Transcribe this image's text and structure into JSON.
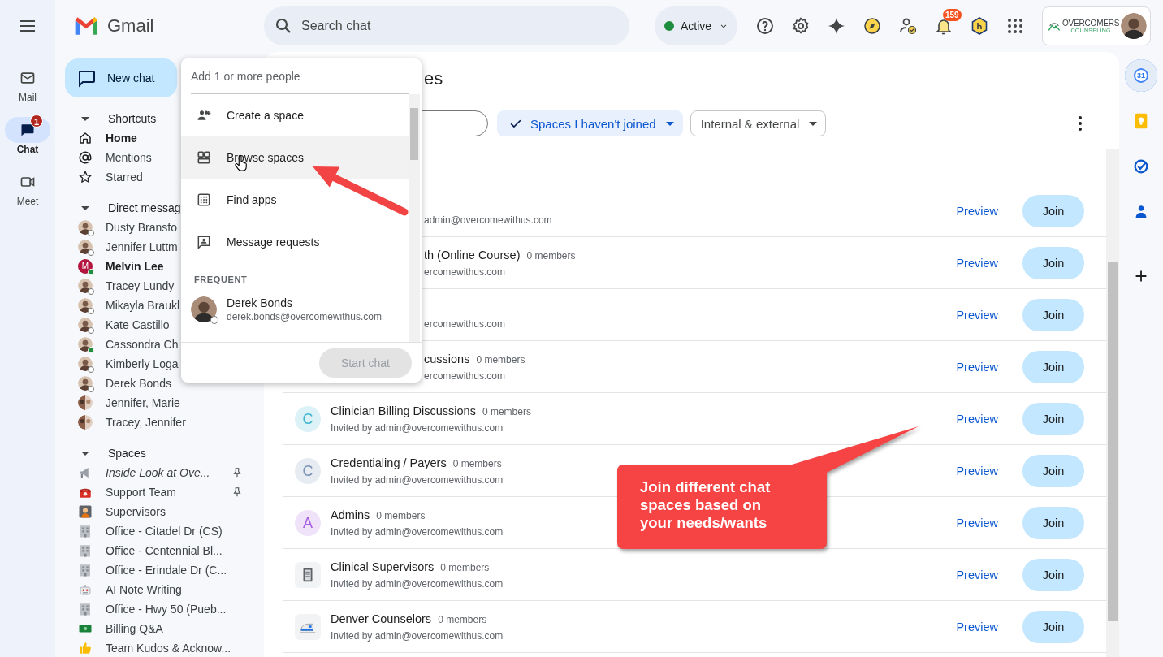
{
  "rail": {
    "items": [
      {
        "kind": "mail",
        "label": "Mail",
        "selected": false
      },
      {
        "kind": "chat",
        "label": "Chat",
        "selected": true,
        "badge": "1"
      },
      {
        "kind": "meet",
        "label": "Meet",
        "selected": false
      }
    ]
  },
  "app": {
    "name": "Gmail"
  },
  "search": {
    "placeholder": "Search chat"
  },
  "presence": {
    "label": "Active"
  },
  "toolbar": {
    "notification_count": "159"
  },
  "account": {
    "org_name": "OVERCOMERS",
    "org_tagline": "COUNSELING"
  },
  "sidebar": {
    "new_chat": "New chat",
    "sections": [
      {
        "title": "Shortcuts",
        "expanded": true,
        "items": [
          {
            "kind": "home",
            "label": "Home",
            "unread": true
          },
          {
            "kind": "mention",
            "label": "Mentions",
            "unread": false
          },
          {
            "kind": "star",
            "label": "Starred",
            "unread": false
          }
        ]
      },
      {
        "title": "Direct messag",
        "expanded": true,
        "items": [
          {
            "kind": "person",
            "label": "Dusty Bransfo",
            "unread": false,
            "online": false
          },
          {
            "kind": "person",
            "label": "Jennifer Luttm",
            "unread": false,
            "online": false
          },
          {
            "kind": "letter",
            "initial": "M",
            "label": "Melvin Lee",
            "unread": true,
            "online": true
          },
          {
            "kind": "person",
            "label": "Tracey Lundy",
            "unread": false,
            "online": false
          },
          {
            "kind": "person",
            "label": "Mikayla Braukl",
            "unread": false,
            "online": false
          },
          {
            "kind": "person",
            "label": "Kate Castillo",
            "unread": false,
            "online": false
          },
          {
            "kind": "person",
            "label": "Cassondra Ch",
            "unread": false,
            "online": true
          },
          {
            "kind": "person",
            "label": "Kimberly Loga",
            "unread": false,
            "online": false
          },
          {
            "kind": "person",
            "label": "Derek Bonds",
            "unread": false,
            "online": false
          },
          {
            "kind": "group",
            "label": "Jennifer, Marie",
            "unread": false,
            "online": false
          },
          {
            "kind": "group",
            "label": "Tracey, Jennifer",
            "unread": false,
            "online": false
          }
        ]
      },
      {
        "title": "Spaces",
        "expanded": true,
        "items": [
          {
            "kind": "megaphone",
            "label": "Inside Look at Ove...",
            "unread": false,
            "italic": true,
            "pinned": true
          },
          {
            "kind": "phone",
            "label": "Support Team",
            "unread": false,
            "italic": false,
            "pinned": true
          },
          {
            "kind": "teacher",
            "label": "Supervisors",
            "unread": false,
            "italic": false,
            "pinned": false
          },
          {
            "kind": "building",
            "label": "Office - Citadel Dr (CS)",
            "unread": false,
            "italic": false,
            "pinned": false
          },
          {
            "kind": "building",
            "label": "Office - Centennial Bl...",
            "unread": false,
            "italic": false,
            "pinned": false
          },
          {
            "kind": "building",
            "label": "Office - Erindale Dr (C...",
            "unread": false,
            "italic": false,
            "pinned": false
          },
          {
            "kind": "robot",
            "label": "AI Note Writing",
            "unread": false,
            "italic": false,
            "pinned": false
          },
          {
            "kind": "building",
            "label": "Office - Hwy 50 (Pueb...",
            "unread": false,
            "italic": false,
            "pinned": false
          },
          {
            "kind": "cash",
            "label": "Billing Q&A",
            "unread": false,
            "italic": false,
            "pinned": false
          },
          {
            "kind": "thumb",
            "label": "Team Kudos & Acknow...",
            "unread": false,
            "italic": false,
            "pinned": false
          }
        ]
      }
    ]
  },
  "new_chat_menu": {
    "placeholder": "Add 1 or more people",
    "actions": [
      {
        "kind": "create",
        "label": "Create a space",
        "hovered": false
      },
      {
        "kind": "browse",
        "label": "Browse spaces",
        "hovered": true
      },
      {
        "kind": "apps",
        "label": "Find apps",
        "hovered": false
      },
      {
        "kind": "requests",
        "label": "Message requests",
        "hovered": false
      }
    ],
    "section_title": "FREQUENT",
    "contacts": [
      {
        "name": "Derek Bonds",
        "email": "derek.bonds@overcomewithus.com",
        "online": false
      }
    ],
    "start_button": {
      "label": "Start chat",
      "disabled": true
    }
  },
  "browse": {
    "title": "es",
    "filters": [
      {
        "kind": "search"
      },
      {
        "kind": "chip",
        "label": "Spaces I haven't joined",
        "selected": true
      },
      {
        "kind": "chip",
        "label": "Internal & external",
        "selected": false
      }
    ],
    "spaces": [
      {
        "kind": "covered",
        "subtitle": "admin@overcomewithus.com",
        "preview": "Preview",
        "join": "Join"
      },
      {
        "kind": "covered",
        "name": "th (Online Course)",
        "members": "0 members",
        "subtitle": "ercomewithus.com",
        "preview": "Preview",
        "join": "Join"
      },
      {
        "kind": "covered",
        "subtitle": "ercomewithus.com",
        "preview": "Preview",
        "join": "Join"
      },
      {
        "kind": "covered",
        "name": "cussions",
        "members": "0 members",
        "subtitle": "ercomewithus.com",
        "preview": "Preview",
        "join": "Join"
      },
      {
        "kind": "letter",
        "initial": "C",
        "color": "#3fb6cf",
        "name": "Clinician Billing Discussions",
        "members": "0 members",
        "subtitle": "Invited by admin@overcomewithus.com",
        "preview": "Preview",
        "join": "Join"
      },
      {
        "kind": "letter",
        "initial": "C",
        "color": "#7a92b4",
        "name": "Credentialing / Payers",
        "members": "0 members",
        "subtitle": "Invited by admin@overcomewithus.com",
        "preview": "Preview",
        "join": "Join"
      },
      {
        "kind": "letter",
        "initial": "A",
        "color": "#a45fe0",
        "name": "Admins",
        "members": "0 members",
        "subtitle": "Invited by admin@overcomewithus.com",
        "preview": "Preview",
        "join": "Join"
      },
      {
        "kind": "notebook",
        "name": "Clinical Supervisors",
        "members": "0 members",
        "subtitle": "Invited by admin@overcomewithus.com",
        "preview": "Preview",
        "join": "Join"
      },
      {
        "kind": "train",
        "name": "Denver Counselors",
        "members": "0 members",
        "subtitle": "Invited by admin@overcomewithus.com",
        "preview": "Preview",
        "join": "Join"
      }
    ]
  },
  "apps_panel": {
    "calendar_day": "31"
  },
  "callout": {
    "text": "Join different chat spaces based on your needs/wants"
  }
}
